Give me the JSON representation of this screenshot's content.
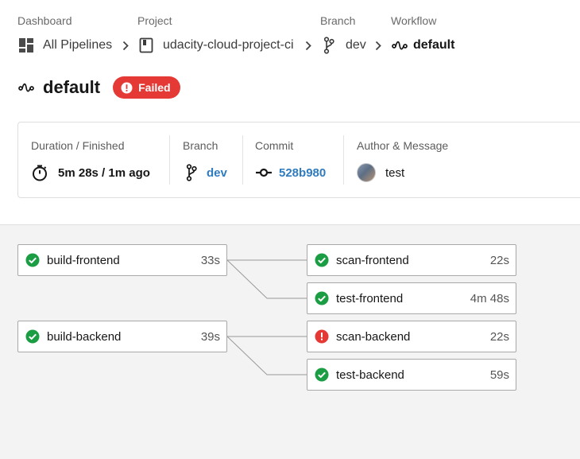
{
  "breadcrumb": {
    "dashboard": {
      "label": "Dashboard",
      "value": "All Pipelines"
    },
    "project": {
      "label": "Project",
      "value": "udacity-cloud-project-ci"
    },
    "branch": {
      "label": "Branch",
      "value": "dev"
    },
    "workflow": {
      "label": "Workflow",
      "value": "default"
    }
  },
  "header": {
    "title": "default",
    "status": "Failed"
  },
  "summary": {
    "duration": {
      "label": "Duration / Finished",
      "value": "5m 28s / 1m ago"
    },
    "branch": {
      "label": "Branch",
      "value": "dev"
    },
    "commit": {
      "label": "Commit",
      "value": "528b980"
    },
    "author": {
      "label": "Author & Message",
      "value": "test"
    }
  },
  "jobs": {
    "build_frontend": {
      "name": "build-frontend",
      "duration": "33s",
      "status": "success"
    },
    "build_backend": {
      "name": "build-backend",
      "duration": "39s",
      "status": "success"
    },
    "scan_frontend": {
      "name": "scan-frontend",
      "duration": "22s",
      "status": "success"
    },
    "test_frontend": {
      "name": "test-frontend",
      "duration": "4m 48s",
      "status": "success"
    },
    "scan_backend": {
      "name": "scan-backend",
      "duration": "22s",
      "status": "failed"
    },
    "test_backend": {
      "name": "test-backend",
      "duration": "59s",
      "status": "success"
    }
  },
  "colors": {
    "success": "#1a9d43",
    "failed": "#e53935",
    "link": "#2f7bbf"
  },
  "icons": {
    "dashboard": "dashboard-icon",
    "project": "project-book-icon",
    "branch": "git-branch-icon",
    "workflow": "workflow-icon",
    "timer": "stopwatch-icon",
    "commit": "git-commit-icon"
  }
}
